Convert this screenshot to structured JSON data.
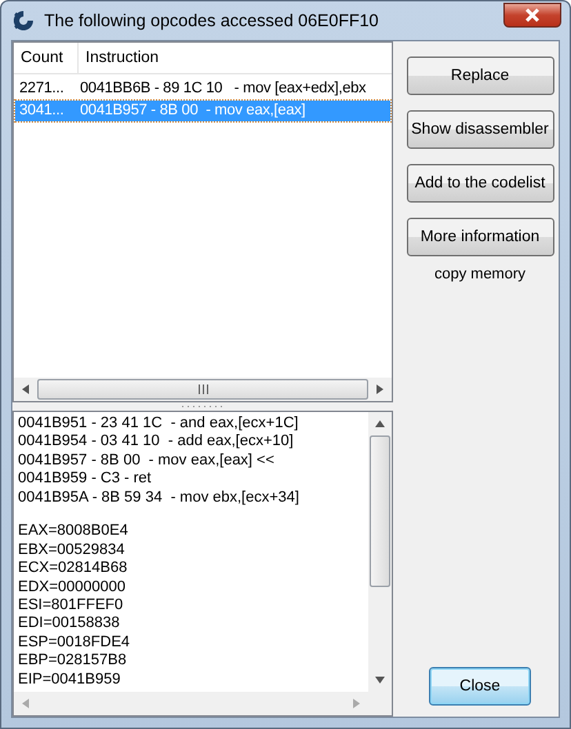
{
  "window": {
    "title": "The following opcodes accessed 06E0FF10"
  },
  "table": {
    "columns": [
      "Count",
      "Instruction"
    ],
    "rows": [
      {
        "cells": [
          "2271...",
          "0041BB6B - 89 1C 10   - mov [eax+edx],ebx"
        ],
        "selected": false
      },
      {
        "cells": [
          "3041...",
          "0041B957 - 8B 00  - mov eax,[eax]"
        ],
        "selected": true
      }
    ]
  },
  "buttons": [
    "Replace",
    "Show disassembler",
    "Add to the codelist",
    "More information"
  ],
  "copy_memory": "copy memory",
  "details": {
    "disassembly": [
      "0041B951 - 23 41 1C  - and eax,[ecx+1C]",
      "0041B954 - 03 41 10  - add eax,[ecx+10]",
      "0041B957 - 8B 00  - mov eax,[eax] <<",
      "0041B959 - C3 - ret",
      "0041B95A - 8B 59 34  - mov ebx,[ecx+34]"
    ],
    "registers": [
      "EAX=8008B0E4",
      "EBX=00529834",
      "ECX=02814B68",
      "EDX=00000000",
      "ESI=801FFEF0",
      "EDI=00158838",
      "ESP=0018FDE4",
      "EBP=028157B8",
      "EIP=0041B959"
    ]
  },
  "close_button": "Close"
}
